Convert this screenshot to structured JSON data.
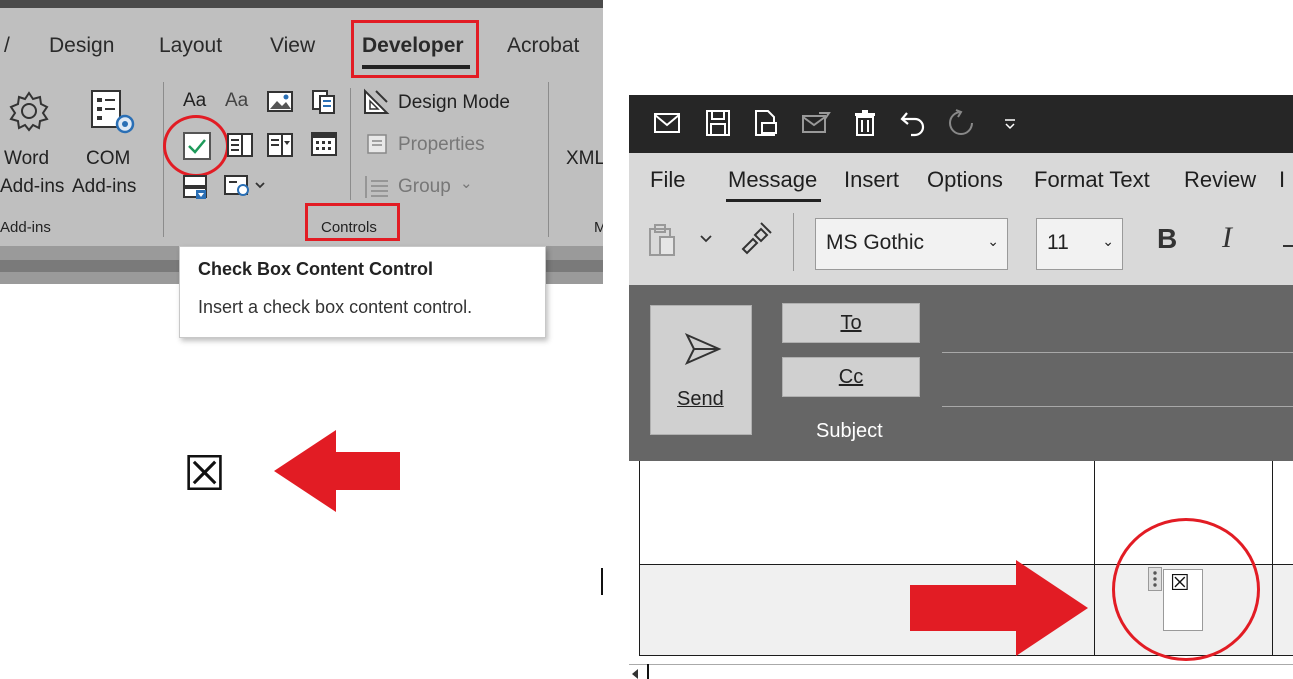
{
  "word_ribbon": {
    "tabs": [
      "/",
      "Design",
      "Layout",
      "View",
      "Developer",
      "Acrobat"
    ],
    "addins": {
      "word_label_line1": "Word",
      "word_label_line2": "Add-ins",
      "com_label_line1": "COM",
      "com_label_line2": "Add-ins",
      "group_label": "Add-ins"
    },
    "controls": {
      "design_mode": "Design Mode",
      "properties": "Properties",
      "group": "Group",
      "group_chevron": "⌄",
      "group_label": "Controls",
      "xml_label": "XML",
      "aa1": "Aa",
      "aa2": "Aa",
      "next_group_label": "M"
    },
    "tooltip": {
      "title": "Check Box Content Control",
      "description": "Insert a check box content control."
    }
  },
  "left_demo": {
    "checkbox_symbol": "☒"
  },
  "outlook": {
    "tabs": [
      "File",
      "Message",
      "Insert",
      "Options",
      "Format Text",
      "Review",
      "I"
    ],
    "font_name": "MS Gothic",
    "font_size": "11",
    "bold": "B",
    "italic": "I",
    "dropdown_chevron": "⌄",
    "send_label": "Send",
    "to_label": "To",
    "cc_label": "Cc",
    "subject_label": "Subject",
    "checkbox_symbol": "☒"
  },
  "colors": {
    "annotation_red": "#e21c24",
    "outlook_dark": "#262626",
    "outlook_ribbon": "#d9d9d9",
    "outlook_header": "#666666",
    "word_ribbon": "#bfbfbf"
  }
}
